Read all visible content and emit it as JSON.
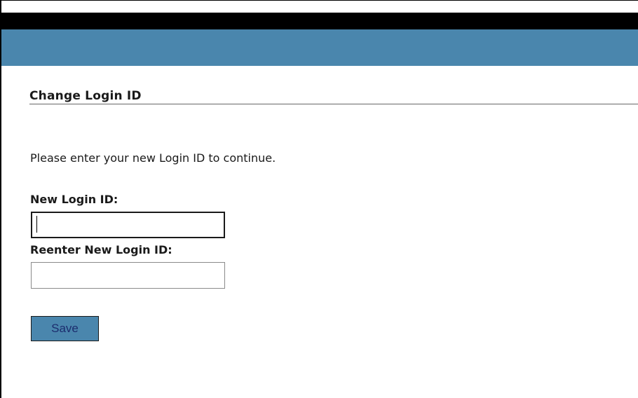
{
  "page": {
    "section_title": "Change Login ID",
    "instructions": "Please enter your new Login ID to continue."
  },
  "form": {
    "new_login_label": "New Login ID:",
    "new_login_value": "",
    "reenter_login_label": "Reenter New Login ID:",
    "reenter_login_value": "",
    "save_label": "Save"
  },
  "colors": {
    "header_black": "#000000",
    "header_blue": "#4a86ad",
    "button_bg": "#4a86ad",
    "button_text": "#1c2d6e"
  }
}
